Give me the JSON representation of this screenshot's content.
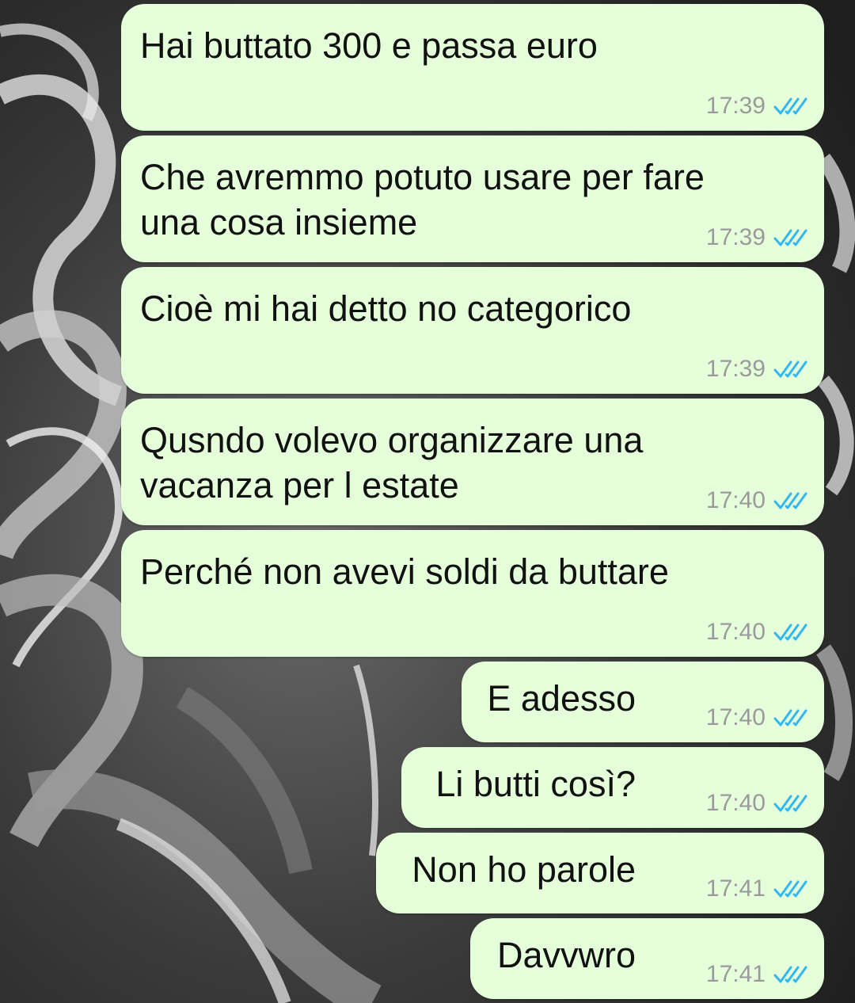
{
  "accent_color": "#e6ffdb",
  "read_tick_color": "#34b7f1",
  "messages": [
    {
      "text": "Hai buttato 300 e passa euro",
      "time": "17:39",
      "status_icon": "double-check-read-icon"
    },
    {
      "text": "Che avremmo potuto usare per fare\nuna cosa insieme",
      "time": "17:39",
      "status_icon": "double-check-read-icon"
    },
    {
      "text": "Cioè mi hai detto no categorico",
      "time": "17:39",
      "status_icon": "double-check-read-icon"
    },
    {
      "text": "Qusndo volevo organizzare una\nvacanza per l estate",
      "time": "17:40",
      "status_icon": "double-check-read-icon"
    },
    {
      "text": "Perché non avevi soldi da buttare",
      "time": "17:40",
      "status_icon": "double-check-read-icon"
    },
    {
      "text": "E adesso",
      "time": "17:40",
      "status_icon": "double-check-read-icon"
    },
    {
      "text": "Li butti così?",
      "time": "17:40",
      "status_icon": "double-check-read-icon"
    },
    {
      "text": "Non ho parole",
      "time": "17:41",
      "status_icon": "double-check-read-icon"
    },
    {
      "text": "Davvwro",
      "time": "17:41",
      "status_icon": "double-check-read-icon"
    }
  ]
}
